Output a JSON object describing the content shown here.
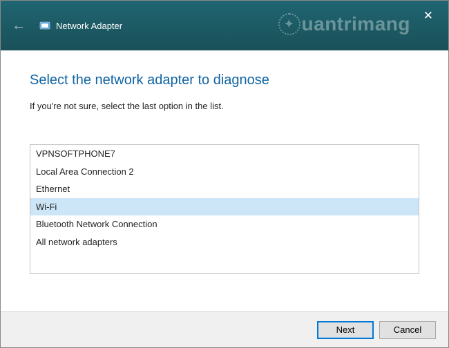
{
  "window": {
    "title": "Network Adapter"
  },
  "watermark": {
    "text": "uantrimang"
  },
  "page": {
    "heading": "Select the network adapter to diagnose",
    "subtext": "If you're not sure, select the last option in the list."
  },
  "adapters": {
    "items": [
      "VPNSOFTPHONE7",
      "Local Area Connection 2",
      "Ethernet",
      "Wi-Fi",
      "Bluetooth Network Connection",
      "All network adapters"
    ],
    "selected_index": 3
  },
  "buttons": {
    "next": "Next",
    "cancel": "Cancel"
  }
}
